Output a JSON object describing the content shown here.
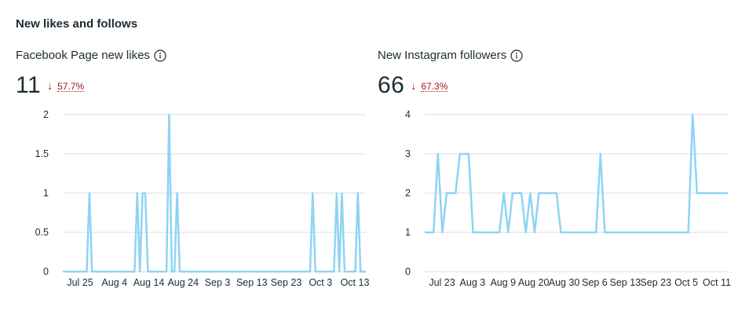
{
  "section_title": "New likes and follows",
  "charts": [
    {
      "title": "Facebook Page new likes",
      "info_icon": "info-icon",
      "value": "11",
      "trend_icon": "arrow-down-icon",
      "trend_arrow": "↓",
      "trend_pct": "57.7%",
      "trend_color": "#a3171d",
      "line_color": "#8fd3f5",
      "chart_data": {
        "type": "line",
        "y_ticks": [
          "0",
          "0.5",
          "1",
          "1.5",
          "2"
        ],
        "ylim": [
          0,
          2
        ],
        "x_ticks": [
          "Jul 25",
          "Aug 4",
          "Aug 14",
          "Aug 24",
          "Sep 3",
          "Sep 13",
          "Sep 23",
          "Oct 3",
          "Oct 13"
        ],
        "grid": true,
        "series": [
          {
            "values": [
              0,
              0,
              0,
              0,
              0,
              0,
              0,
              0,
              0,
              0,
              1,
              0,
              0,
              0,
              0,
              0,
              0,
              0,
              0,
              0,
              0,
              0,
              0,
              0,
              0,
              0,
              0,
              0,
              1,
              0,
              1,
              1,
              0,
              0,
              0,
              0,
              0,
              0,
              0,
              0,
              2,
              0,
              0,
              1,
              0,
              0,
              0,
              0,
              0,
              0,
              0,
              0,
              0,
              0,
              0,
              0,
              0,
              0,
              0,
              0,
              0,
              0,
              0,
              0,
              0,
              0,
              0,
              0,
              0,
              0,
              0,
              0,
              0,
              0,
              0,
              0,
              0,
              0,
              0,
              0,
              0,
              0,
              0,
              0,
              0,
              0,
              0,
              0,
              0,
              0,
              0,
              0,
              0,
              0,
              1,
              0,
              0,
              0,
              0,
              0,
              0,
              0,
              0,
              1,
              0,
              1,
              0,
              0,
              0,
              0,
              0,
              1,
              0,
              0,
              0
            ]
          }
        ]
      }
    },
    {
      "title": "New Instagram followers",
      "info_icon": "info-icon",
      "value": "66",
      "trend_icon": "arrow-down-icon",
      "trend_arrow": "↓",
      "trend_pct": "67.3%",
      "trend_color": "#a3171d",
      "line_color": "#8fd3f5",
      "chart_data": {
        "type": "line",
        "y_ticks": [
          "0",
          "1",
          "2",
          "3",
          "4"
        ],
        "ylim": [
          0,
          4
        ],
        "x_ticks": [
          "Jul 23",
          "Aug 3",
          "Aug 9",
          "Aug 20",
          "Aug 30",
          "Sep 6",
          "Sep 13",
          "Sep 23",
          "Oct 5",
          "Oct 11"
        ],
        "grid": true,
        "series": [
          {
            "values": [
              1,
              1,
              1,
              3,
              1,
              2,
              2,
              2,
              3,
              3,
              3,
              1,
              1,
              1,
              1,
              1,
              1,
              1,
              2,
              1,
              2,
              2,
              2,
              1,
              2,
              1,
              2,
              2,
              2,
              2,
              2,
              1,
              1,
              1,
              1,
              1,
              1,
              1,
              1,
              1,
              3,
              1,
              1,
              1,
              1,
              1,
              1,
              1,
              1,
              1,
              1,
              1,
              1,
              1,
              1,
              1,
              1,
              1,
              1,
              1,
              1,
              4,
              2,
              2,
              2,
              2,
              2,
              2,
              2,
              2
            ]
          }
        ]
      }
    }
  ]
}
